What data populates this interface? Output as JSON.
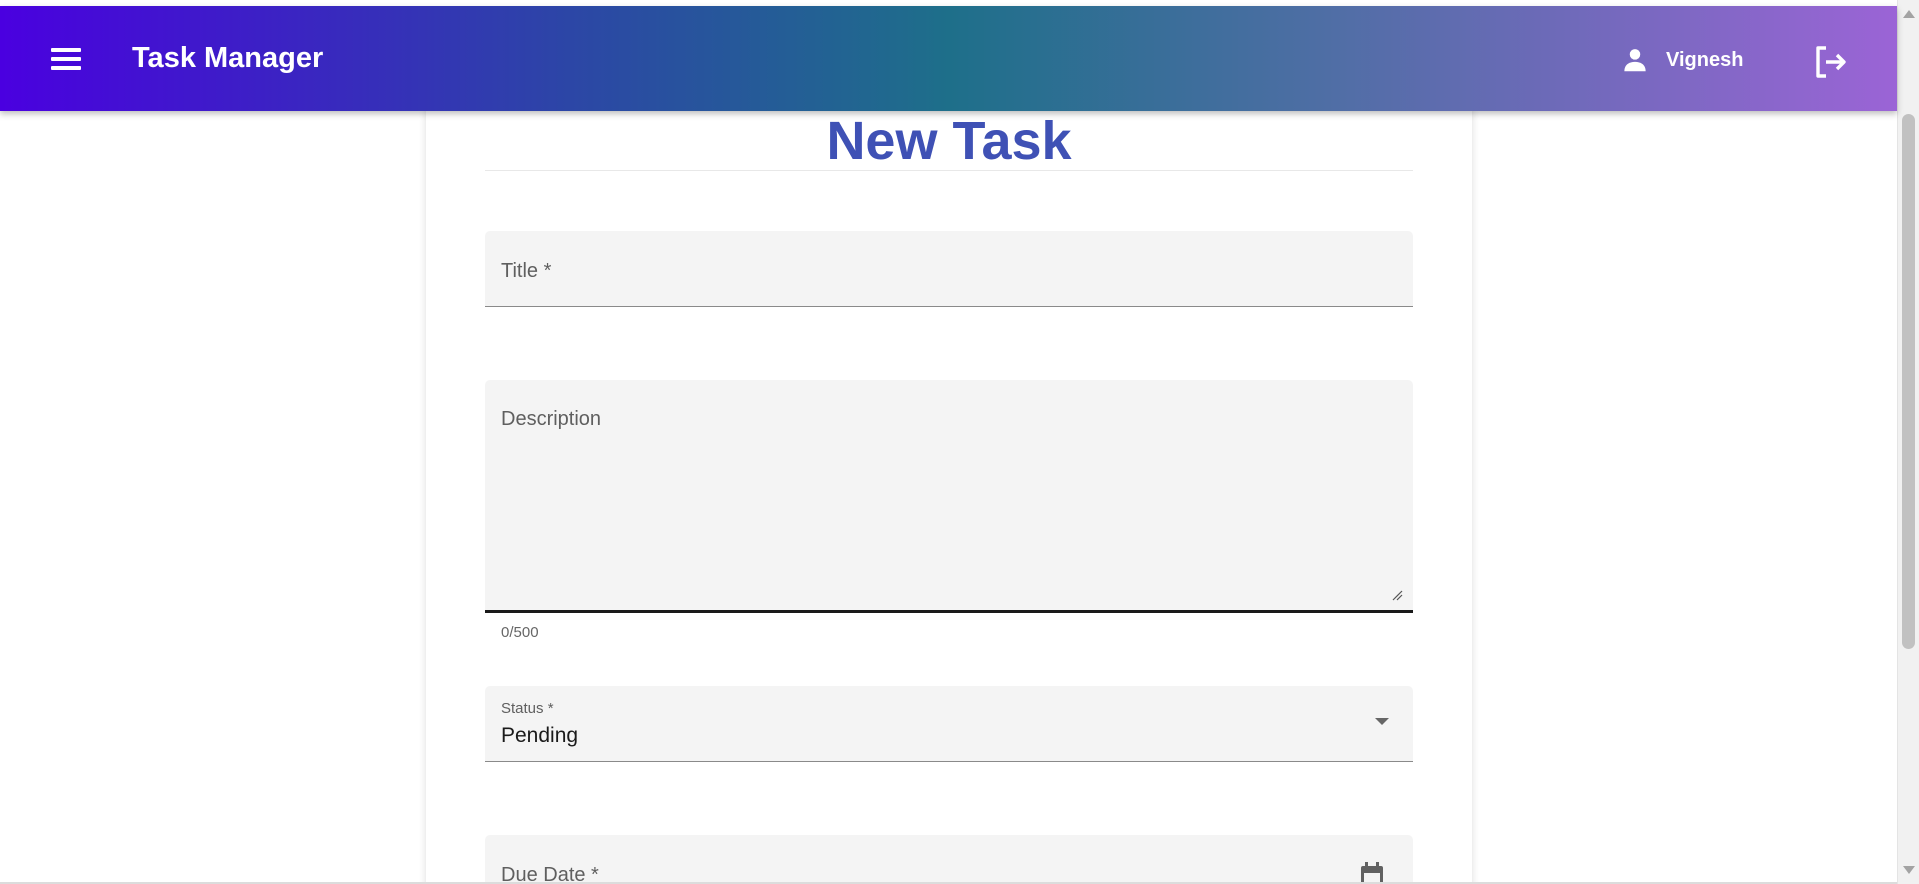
{
  "app": {
    "title": "Task Manager",
    "menu_icon": "menu-icon"
  },
  "user": {
    "name": "Vignesh",
    "icon": "person-icon",
    "logout_icon": "logout-icon"
  },
  "form": {
    "heading": "New Task",
    "title_field": {
      "label": "Title *",
      "value": ""
    },
    "description_field": {
      "label": "Description",
      "value": "",
      "counter": "0/500"
    },
    "status_field": {
      "label": "Status *",
      "value": "Pending"
    },
    "due_date_field": {
      "label": "Due Date *",
      "value": "",
      "icon": "calendar-icon"
    }
  },
  "colors": {
    "toolbar_gradient": [
      "#4a00e0",
      "#2c46a6",
      "#1e6f8a",
      "#4f6ea5",
      "#9b64d6"
    ],
    "heading": "#3f51b5",
    "field_background": "#f4f4f4"
  }
}
